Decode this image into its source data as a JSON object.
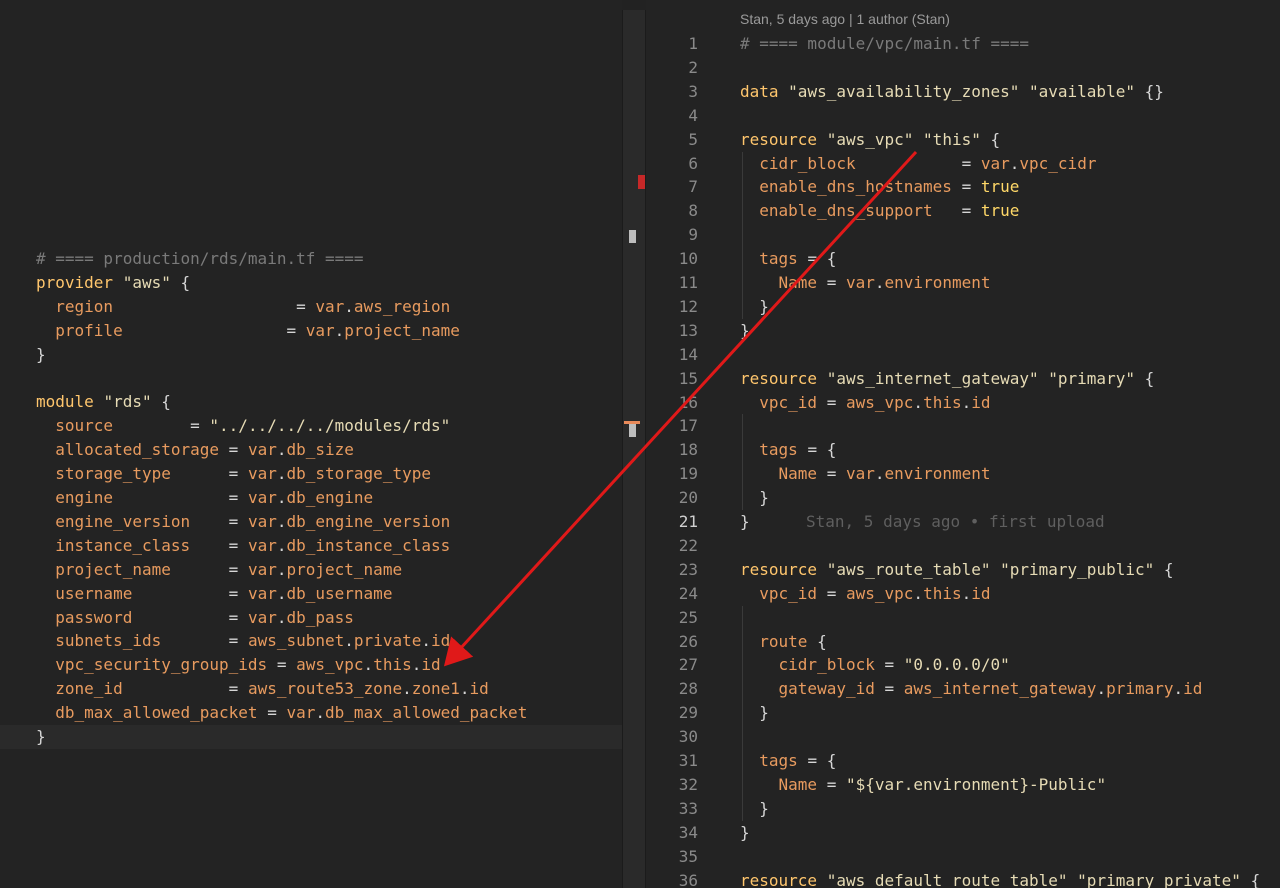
{
  "left_editor": {
    "lines": [
      "# ==== production/rds/main.tf ====",
      "provider \"aws\" {",
      "  region                   = var.aws_region",
      "  profile                 = var.project_name",
      "}",
      "",
      "module \"rds\" {",
      "  source        = \"../../../../modules/rds\"",
      "  allocated_storage = var.db_size",
      "  storage_type      = var.db_storage_type",
      "  engine            = var.db_engine",
      "  engine_version    = var.db_engine_version",
      "  instance_class    = var.db_instance_class",
      "  project_name      = var.project_name",
      "  username          = var.db_username",
      "  password          = var.db_pass",
      "  subnets_ids       = aws_subnet.private.id",
      "  vpc_security_group_ids = aws_vpc.this.id",
      "  zone_id           = aws_route53_zone.zone1.id",
      "  db_max_allowed_packet = var.db_max_allowed_packet",
      "}"
    ]
  },
  "right_editor": {
    "blame_header": "Stan, 5 days ago | 1 author (Stan)",
    "blame_inline": "Stan, 5 days ago • first upload",
    "line_numbers": [
      "1",
      "2",
      "3",
      "4",
      "5",
      "6",
      "7",
      "8",
      "9",
      "10",
      "11",
      "12",
      "13",
      "14",
      "15",
      "16",
      "17",
      "18",
      "19",
      "20",
      "21",
      "22",
      "23",
      "24",
      "25",
      "26",
      "27",
      "28",
      "29",
      "30",
      "31",
      "32",
      "33",
      "34",
      "35",
      "36"
    ],
    "lines": [
      "# ==== module/vpc/main.tf ====",
      "",
      "data \"aws_availability_zones\" \"available\" {}",
      "",
      "resource \"aws_vpc\" \"this\" {",
      "  cidr_block           = var.vpc_cidr",
      "  enable_dns_hostnames = true",
      "  enable_dns_support   = true",
      "",
      "  tags = {",
      "    Name = var.environment",
      "  }",
      "}",
      "",
      "resource \"aws_internet_gateway\" \"primary\" {",
      "  vpc_id = aws_vpc.this.id",
      "",
      "  tags = {",
      "    Name = var.environment",
      "  }",
      "}",
      "",
      "resource \"aws_route_table\" \"primary_public\" {",
      "  vpc_id = aws_vpc.this.id",
      "",
      "  route {",
      "    cidr_block = \"0.0.0.0/0\"",
      "    gateway_id = aws_internet_gateway.primary.id",
      "  }",
      "",
      "  tags = {",
      "    Name = \"${var.environment}-Public\"",
      "  }",
      "}",
      "",
      "resource \"aws_default_route_table\" \"primary_private\" {"
    ]
  },
  "colors": {
    "background": "#232323",
    "arrow": "#e01919",
    "keyword": "#ffc66d",
    "attribute": "#e89b5f",
    "comment": "#7a7a7a"
  }
}
